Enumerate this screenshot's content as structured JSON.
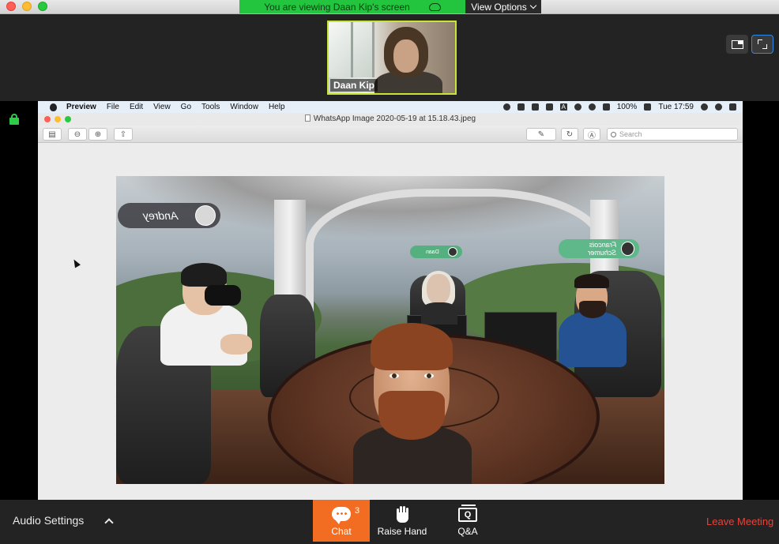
{
  "zoom": {
    "share_banner": "You are viewing Daan Kip's screen",
    "view_options": "View Options",
    "participant_name": "Daan Kip"
  },
  "mac_menubar": {
    "app": "Preview",
    "items": [
      "File",
      "Edit",
      "View",
      "Go",
      "Tools",
      "Window",
      "Help"
    ],
    "battery": "100%",
    "clock": "Tue 17:59",
    "input_badge": "A"
  },
  "preview": {
    "window_title": "WhatsApp Image 2020-05-19 at 15.18.43.jpeg",
    "search_placeholder": "Search"
  },
  "scene": {
    "tags": {
      "andrey": "Andrey",
      "daan": "Daan",
      "francois": "Francois Schumer"
    }
  },
  "controls": {
    "audio_settings": "Audio Settings",
    "chat": "Chat",
    "chat_badge": "3",
    "raise_hand": "Raise Hand",
    "qa": "Q&A",
    "qa_icon_letter": "Q",
    "leave": "Leave Meeting"
  },
  "colors": {
    "share_green": "#22c53d",
    "chat_orange": "#f26d21",
    "leave_red": "#e8433a",
    "active_speaker": "#c9e338"
  }
}
